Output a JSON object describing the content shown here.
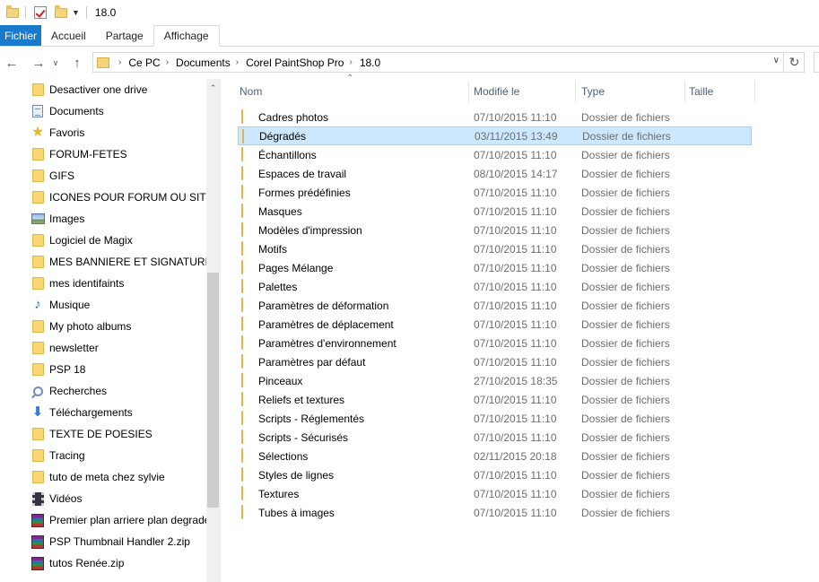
{
  "window": {
    "title": "18.0"
  },
  "ribbon": {
    "tabs": [
      "Fichier",
      "Accueil",
      "Partage",
      "Affichage"
    ]
  },
  "address": {
    "crumbs": [
      "Ce PC",
      "Documents",
      "Corel PaintShop Pro",
      "18.0"
    ]
  },
  "nav": {
    "items": [
      {
        "label": "Desactiver one drive",
        "icon": "folder-icon"
      },
      {
        "label": "Documents",
        "icon": "documents-icon"
      },
      {
        "label": "Favoris",
        "icon": "star-icon"
      },
      {
        "label": "FORUM-FETES",
        "icon": "folder-icon"
      },
      {
        "label": "GIFS",
        "icon": "folder-icon"
      },
      {
        "label": "ICONES POUR FORUM OU SITE",
        "icon": "folder-icon"
      },
      {
        "label": "Images",
        "icon": "pictures-icon"
      },
      {
        "label": "Logiciel de Magix",
        "icon": "folder-icon"
      },
      {
        "label": "MES BANNIERE ET SIGNATURE",
        "icon": "folder-icon"
      },
      {
        "label": "mes identifaints",
        "icon": "folder-icon"
      },
      {
        "label": "Musique",
        "icon": "music-icon"
      },
      {
        "label": "My photo albums",
        "icon": "folder-icon"
      },
      {
        "label": "newsletter",
        "icon": "folder-icon"
      },
      {
        "label": "PSP 18",
        "icon": "folder-icon"
      },
      {
        "label": "Recherches",
        "icon": "search-icon"
      },
      {
        "label": "Téléchargements",
        "icon": "downloads-icon"
      },
      {
        "label": "TEXTE DE POESIES",
        "icon": "folder-icon"
      },
      {
        "label": "Tracing",
        "icon": "folder-icon"
      },
      {
        "label": "tuto de meta chez sylvie",
        "icon": "folder-icon"
      },
      {
        "label": "Vidéos",
        "icon": "videos-icon"
      },
      {
        "label": "Premier plan arriere plan degradé",
        "icon": "archive-icon"
      },
      {
        "label": "PSP Thumbnail Handler 2.zip",
        "icon": "archive-icon"
      },
      {
        "label": "tutos Renée.zip",
        "icon": "archive-icon"
      }
    ]
  },
  "columns": {
    "name": "Nom",
    "modified": "Modifié le",
    "type": "Type",
    "size": "Taille"
  },
  "files": [
    {
      "name": "Cadres photos",
      "modified": "07/10/2015 11:10",
      "type": "Dossier de fichiers"
    },
    {
      "name": "Dégradés",
      "modified": "03/11/2015 13:49",
      "type": "Dossier de fichiers",
      "selected": true
    },
    {
      "name": "Échantillons",
      "modified": "07/10/2015 11:10",
      "type": "Dossier de fichiers"
    },
    {
      "name": "Espaces de travail",
      "modified": "08/10/2015 14:17",
      "type": "Dossier de fichiers"
    },
    {
      "name": "Formes prédéfinies",
      "modified": "07/10/2015 11:10",
      "type": "Dossier de fichiers"
    },
    {
      "name": "Masques",
      "modified": "07/10/2015 11:10",
      "type": "Dossier de fichiers"
    },
    {
      "name": "Modèles d'impression",
      "modified": "07/10/2015 11:10",
      "type": "Dossier de fichiers"
    },
    {
      "name": "Motifs",
      "modified": "07/10/2015 11:10",
      "type": "Dossier de fichiers"
    },
    {
      "name": "Pages Mélange",
      "modified": "07/10/2015 11:10",
      "type": "Dossier de fichiers"
    },
    {
      "name": "Palettes",
      "modified": "07/10/2015 11:10",
      "type": "Dossier de fichiers"
    },
    {
      "name": "Paramètres de déformation",
      "modified": "07/10/2015 11:10",
      "type": "Dossier de fichiers"
    },
    {
      "name": "Paramètres de déplacement",
      "modified": "07/10/2015 11:10",
      "type": "Dossier de fichiers"
    },
    {
      "name": "Paramètres d'environnement",
      "modified": "07/10/2015 11:10",
      "type": "Dossier de fichiers"
    },
    {
      "name": "Paramètres par défaut",
      "modified": "07/10/2015 11:10",
      "type": "Dossier de fichiers"
    },
    {
      "name": "Pinceaux",
      "modified": "27/10/2015 18:35",
      "type": "Dossier de fichiers"
    },
    {
      "name": "Reliefs et textures",
      "modified": "07/10/2015 11:10",
      "type": "Dossier de fichiers"
    },
    {
      "name": "Scripts - Réglementés",
      "modified": "07/10/2015 11:10",
      "type": "Dossier de fichiers"
    },
    {
      "name": "Scripts - Sécurisés",
      "modified": "07/10/2015 11:10",
      "type": "Dossier de fichiers"
    },
    {
      "name": "Sélections",
      "modified": "02/11/2015 20:18",
      "type": "Dossier de fichiers"
    },
    {
      "name": "Styles de lignes",
      "modified": "07/10/2015 11:10",
      "type": "Dossier de fichiers"
    },
    {
      "name": "Textures",
      "modified": "07/10/2015 11:10",
      "type": "Dossier de fichiers"
    },
    {
      "name": "Tubes à images",
      "modified": "07/10/2015 11:10",
      "type": "Dossier de fichiers"
    }
  ],
  "colors": {
    "accent": "#1979ca",
    "selection": "#cce8ff",
    "selection_border": "#99d1ff",
    "folder": "#f8d775"
  }
}
